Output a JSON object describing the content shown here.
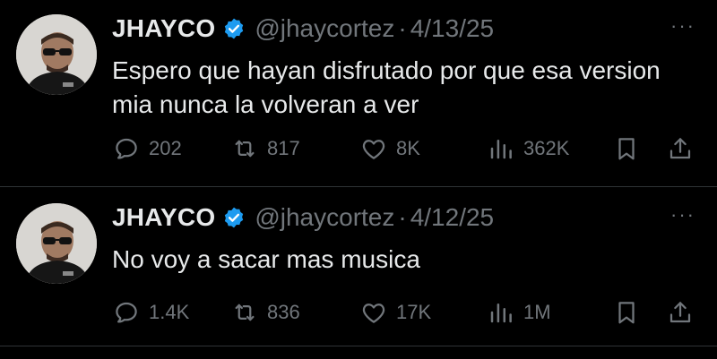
{
  "tweets": [
    {
      "name": "JHAYCO",
      "handle": "@jhaycortez",
      "separator": "·",
      "date": "4/13/25",
      "text": "Espero que hayan disfrutado por que esa version mia nunca la volveran a ver",
      "more": "···",
      "replies": "202",
      "retweets": "817",
      "likes": "8K",
      "views": "362K"
    },
    {
      "name": "JHAYCO",
      "handle": "@jhaycortez",
      "separator": "·",
      "date": "4/12/25",
      "text": "No voy a sacar mas musica",
      "more": "···",
      "replies": "1.4K",
      "retweets": "836",
      "likes": "17K",
      "views": "1M"
    }
  ],
  "colors": {
    "background": "#000000",
    "text": "#e7e9ea",
    "muted": "#71767b",
    "verified": "#1d9bf0",
    "divider": "#2f3336"
  }
}
